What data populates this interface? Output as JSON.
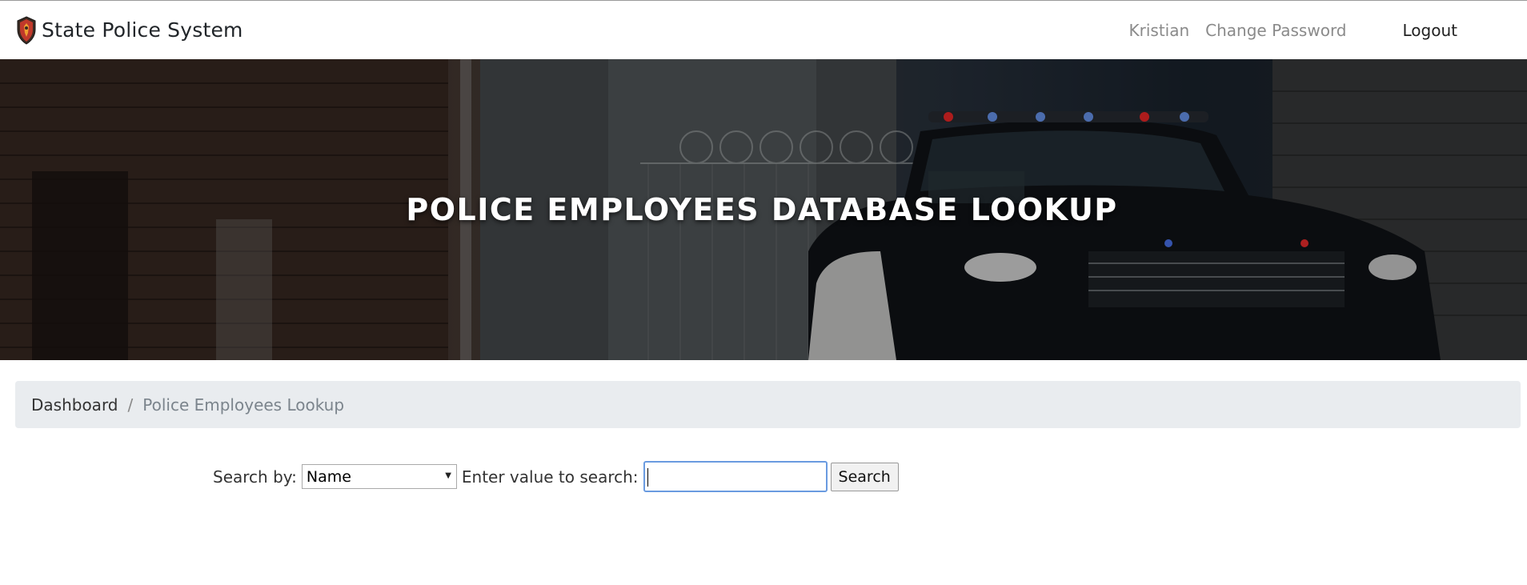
{
  "nav": {
    "brand": "State Police System",
    "user": "Kristian",
    "change_password": "Change Password",
    "logout": "Logout"
  },
  "hero": {
    "title": "POLICE EMPLOYEES DATABASE LOOKUP"
  },
  "breadcrumb": {
    "home": "Dashboard",
    "separator": "/",
    "current": "Police Employees Lookup"
  },
  "search": {
    "search_by_label": "Search by:",
    "selected_option": "Name",
    "value_label": "Enter value to search:",
    "value": "",
    "button": "Search"
  },
  "colors": {
    "breadcrumb_bg": "#e9ecef",
    "input_focus": "#6a9be0",
    "shield_red": "#c0392b"
  }
}
